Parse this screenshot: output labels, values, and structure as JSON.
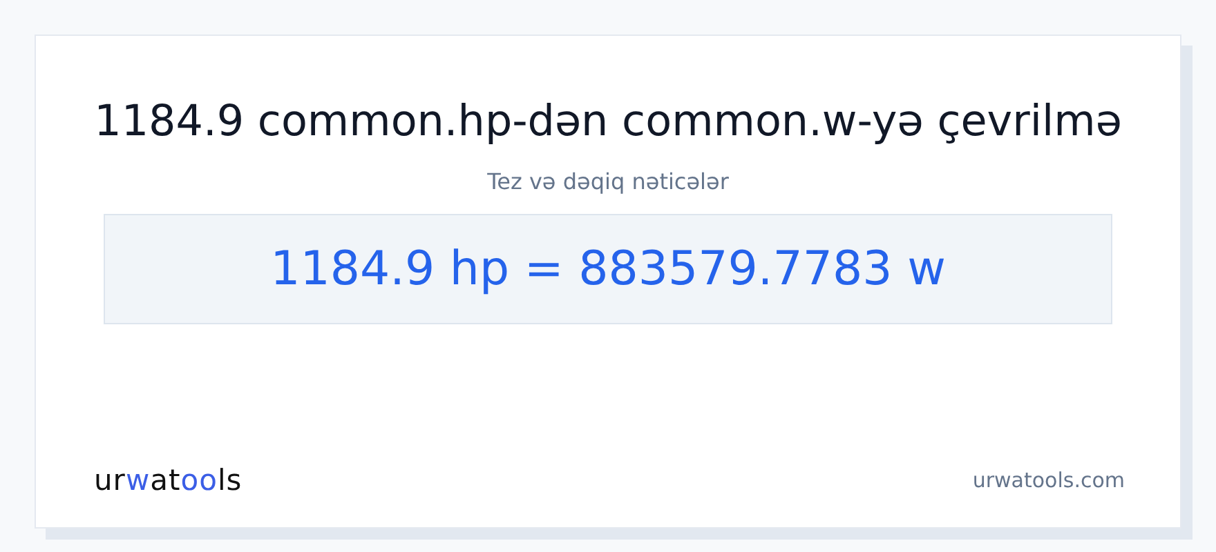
{
  "title": "1184.9 common.hp-dən common.w-yə çevrilmə",
  "subtitle": "Tez və dəqiq nəticələr",
  "result": "1184.9 hp = 883579.7783 w",
  "logo": [
    {
      "text": "ur",
      "accent": false
    },
    {
      "text": "w",
      "accent": true
    },
    {
      "text": "at",
      "accent": false
    },
    {
      "text": "oo",
      "accent": true
    },
    {
      "text": "ls",
      "accent": false
    }
  ],
  "site": "urwatools.com"
}
